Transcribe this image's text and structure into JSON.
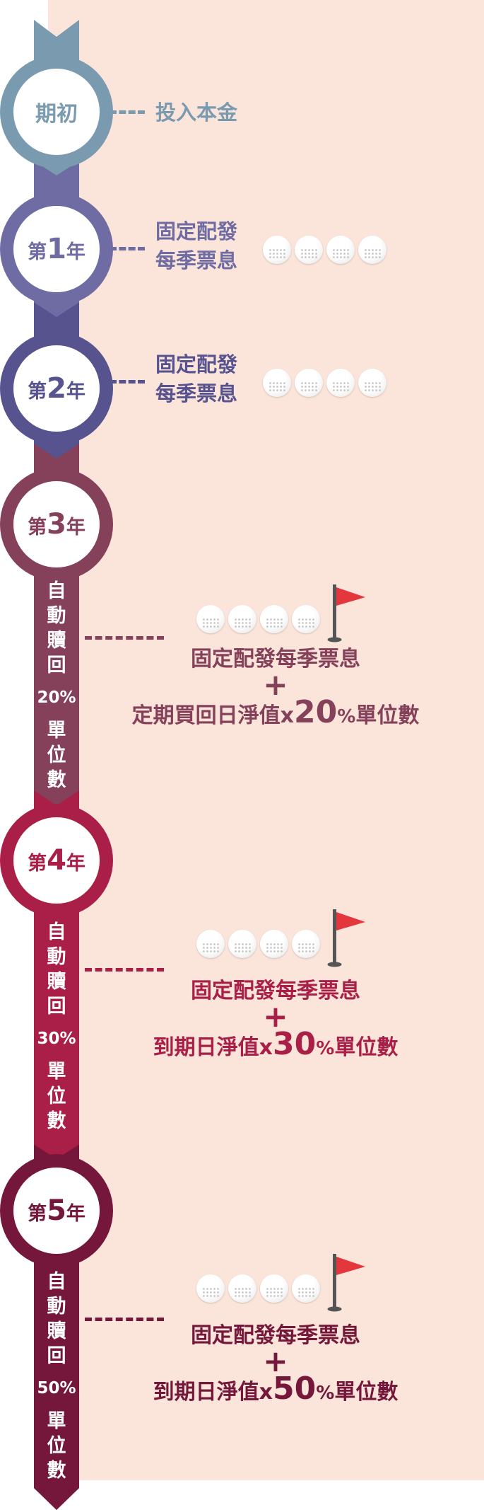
{
  "colors": {
    "background": "#fbe5da",
    "stage0": "#7a9ab0",
    "stage1": "#6f6ca3",
    "stage2": "#56538e",
    "stage3": "#85405a",
    "stage4": "#a91f47",
    "stage5": "#74173a",
    "flag_red": "#e4363d"
  },
  "stages": [
    {
      "prefix": "期初",
      "num": "",
      "suffix": "",
      "desc": [
        "投入本金"
      ]
    },
    {
      "prefix": "第",
      "num": "1",
      "suffix": "年",
      "desc": [
        "固定配發",
        "每季票息"
      ],
      "balls": 4
    },
    {
      "prefix": "第",
      "num": "2",
      "suffix": "年",
      "desc": [
        "固定配發",
        "每季票息"
      ],
      "balls": 4
    },
    {
      "prefix": "第",
      "num": "3",
      "suffix": "年",
      "vertical": [
        "自",
        "動",
        "贖",
        "回"
      ],
      "pct": "20%",
      "vertical2": [
        "單",
        "位",
        "數"
      ],
      "line1": "固定配發每季票息",
      "plus": "+",
      "line3_pre": "定期買回日淨值x",
      "line3_num": "20",
      "line3_pct": "%",
      "line3_post": "單位數",
      "balls": 4,
      "icon": "golf-flag-icon"
    },
    {
      "prefix": "第",
      "num": "4",
      "suffix": "年",
      "vertical": [
        "自",
        "動",
        "贖",
        "回"
      ],
      "pct": "30%",
      "vertical2": [
        "單",
        "位",
        "數"
      ],
      "line1": "固定配發每季票息",
      "plus": "+",
      "line3_pre": "到期日淨值x",
      "line3_num": "30",
      "line3_pct": "%",
      "line3_post": "單位數",
      "balls": 4,
      "icon": "golf-flag-icon"
    },
    {
      "prefix": "第",
      "num": "5",
      "suffix": "年",
      "vertical": [
        "自",
        "動",
        "贖",
        "回"
      ],
      "pct": "50%",
      "vertical2": [
        "單",
        "位",
        "數"
      ],
      "line1": "固定配發每季票息",
      "plus": "+",
      "line3_pre": "到期日淨值x",
      "line3_num": "50",
      "line3_pct": "%",
      "line3_post": "單位數",
      "balls": 4,
      "icon": "golf-flag-icon"
    }
  ]
}
